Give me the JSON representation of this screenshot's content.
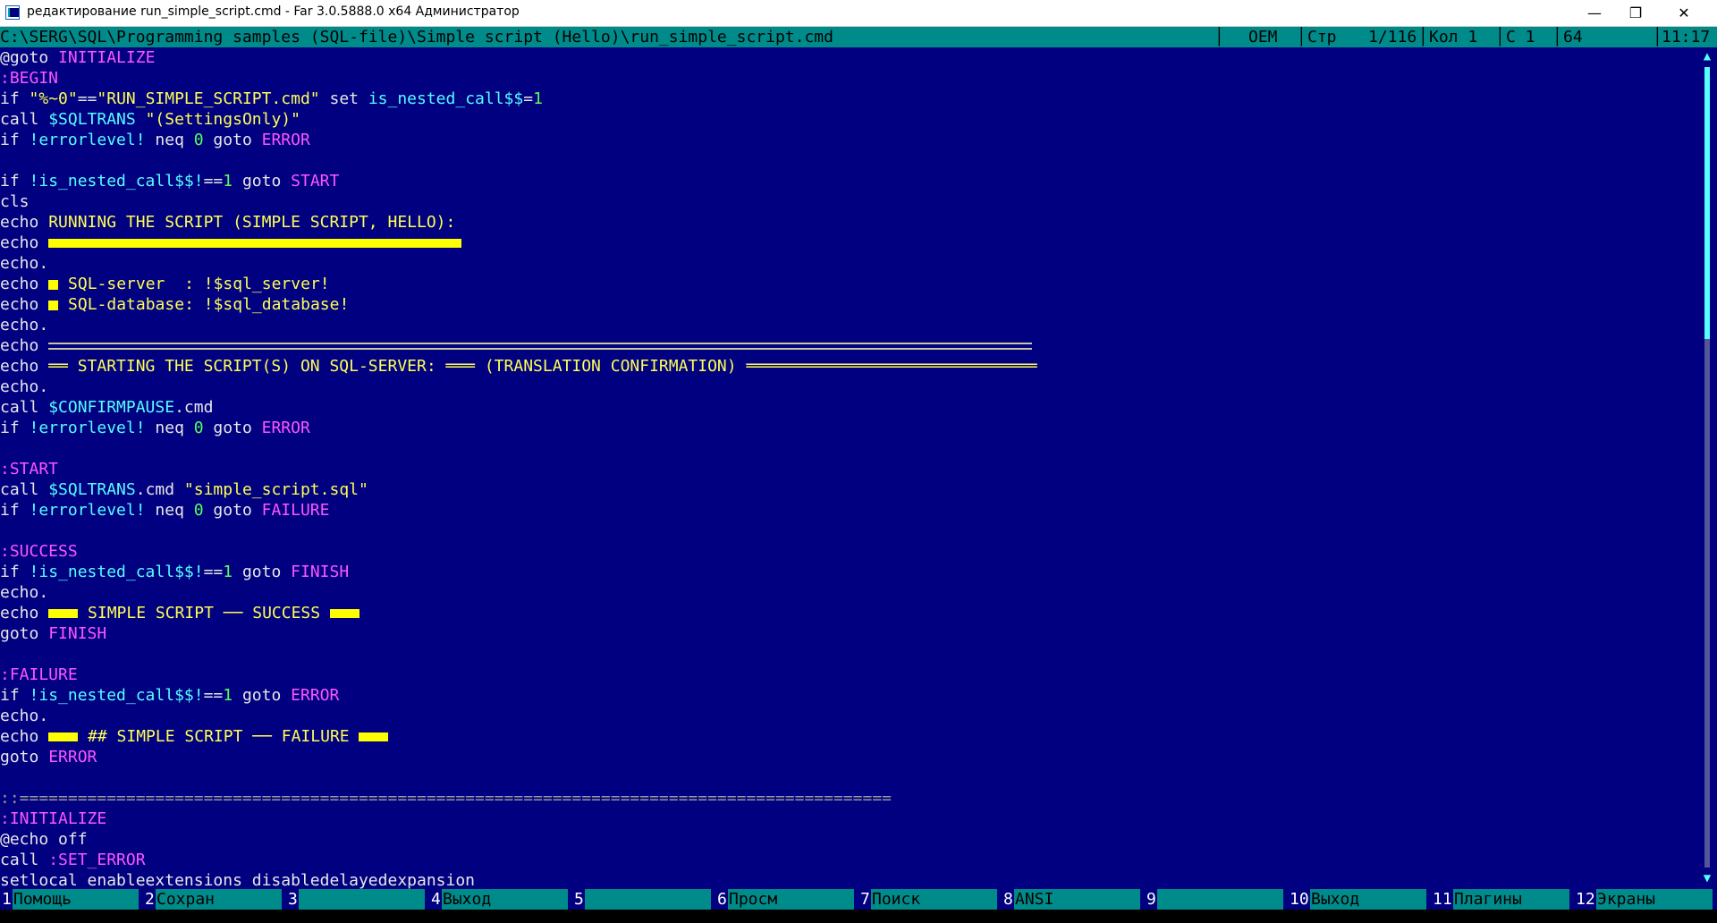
{
  "window": {
    "title": "редактирование run_simple_script.cmd - Far 3.0.5888.0 x64 Администратор",
    "minimize": "—",
    "maximize": "❐",
    "close": "✕"
  },
  "status": {
    "path": "C:\\SERG\\SQL\\Programming samples (SQL-file)\\Simple script (Hello)\\run_simple_script.cmd",
    "codepage": "OEM",
    "line_label": "Стр",
    "line_value": "1/116",
    "col_label": "Кол 1",
    "char_label": "С 1",
    "char_code": "64",
    "time": "11:17"
  },
  "code": {
    "l01_a": "@goto ",
    "l01_b": "INITIALIZE",
    "l02": ":BEGIN",
    "l03_a": "if ",
    "l03_b": "\"%~0\"",
    "l03_c": "==",
    "l03_d": "\"RUN_SIMPLE_SCRIPT.cmd\"",
    "l03_e": " set ",
    "l03_f": "is_nested_call$$",
    "l03_g": "=",
    "l03_h": "1",
    "l04_a": "call ",
    "l04_b": "$SQLTRANS",
    "l04_c": " \"(SettingsOnly)\"",
    "l05_a": "if ",
    "l05_b": "!errorlevel!",
    "l05_c": " neq ",
    "l05_d": "0",
    "l05_e": " goto ",
    "l05_f": "ERROR",
    "l07_a": "if ",
    "l07_b": "!is_nested_call$$!",
    "l07_c": "==",
    "l07_d": "1",
    "l07_e": " goto ",
    "l07_f": "START",
    "l08": "cls",
    "l09_a": "echo ",
    "l09_b": "RUNNING THE SCRIPT (SIMPLE SCRIPT, HELLO):",
    "l10": "echo ",
    "l11": "echo.",
    "l12_a": "echo ",
    "l12_b": " SQL-server  : !$sql_server!",
    "l13_a": "echo ",
    "l13_b": " SQL-database: !$sql_database!",
    "l14": "echo.",
    "l15": "echo ",
    "l16_a": "echo ",
    "l16_b": "══ STARTING THE SCRIPT(S) ON SQL-SERVER: ═══ (TRANSLATION CONFIRMATION) ══════════════════════════════",
    "l17": "echo.",
    "l18_a": "call ",
    "l18_b": "$CONFIRMPAUSE",
    "l18_c": ".cmd",
    "l19_a": "if ",
    "l19_b": "!errorlevel!",
    "l19_c": " neq ",
    "l19_d": "0",
    "l19_e": " goto ",
    "l19_f": "ERROR",
    "l21": ":START",
    "l22_a": "call ",
    "l22_b": "$SQLTRANS",
    "l22_c": ".cmd ",
    "l22_d": "\"simple_script.sql\"",
    "l23_a": "if ",
    "l23_b": "!errorlevel!",
    "l23_c": " neq ",
    "l23_d": "0",
    "l23_e": " goto ",
    "l23_f": "FAILURE",
    "l25": ":SUCCESS",
    "l26_a": "if ",
    "l26_b": "!is_nested_call$$!",
    "l26_c": "==",
    "l26_d": "1",
    "l26_e": " goto ",
    "l26_f": "FINISH",
    "l27": "echo.",
    "l28_a": "echo ",
    "l28_b": " SIMPLE SCRIPT ── SUCCESS ",
    "l29_a": "goto ",
    "l29_b": "FINISH",
    "l31": ":FAILURE",
    "l32_a": "if ",
    "l32_b": "!is_nested_call$$!",
    "l32_c": "==",
    "l32_d": "1",
    "l32_e": " goto ",
    "l32_f": "ERROR",
    "l33": "echo.",
    "l34_a": "echo ",
    "l34_b": " ## SIMPLE SCRIPT ── FAILURE ",
    "l35_a": "goto ",
    "l35_b": "ERROR",
    "l37": "::==========================================================================================",
    "l38": ":INITIALIZE",
    "l39": "@echo off",
    "l40_a": "call ",
    "l40_b": ":SET_ERROR",
    "l41": "setlocal enableextensions disabledelayedexpansion"
  },
  "scrollbar": {
    "up_icon": "▲",
    "down_icon": "▼",
    "position_fraction": 0.0,
    "visible_fraction": 0.34
  },
  "keybar": [
    {
      "num": "1",
      "label": "Помощь"
    },
    {
      "num": "2",
      "label": "Сохран"
    },
    {
      "num": "3",
      "label": ""
    },
    {
      "num": "4",
      "label": "Выход"
    },
    {
      "num": "5",
      "label": ""
    },
    {
      "num": "6",
      "label": "Просм"
    },
    {
      "num": "7",
      "label": "Поиск"
    },
    {
      "num": "8",
      "label": "ANSI"
    },
    {
      "num": "9",
      "label": ""
    },
    {
      "num": "10",
      "label": "Выход"
    },
    {
      "num": "11",
      "label": "Плагины"
    },
    {
      "num": "12",
      "label": "Экраны"
    }
  ]
}
